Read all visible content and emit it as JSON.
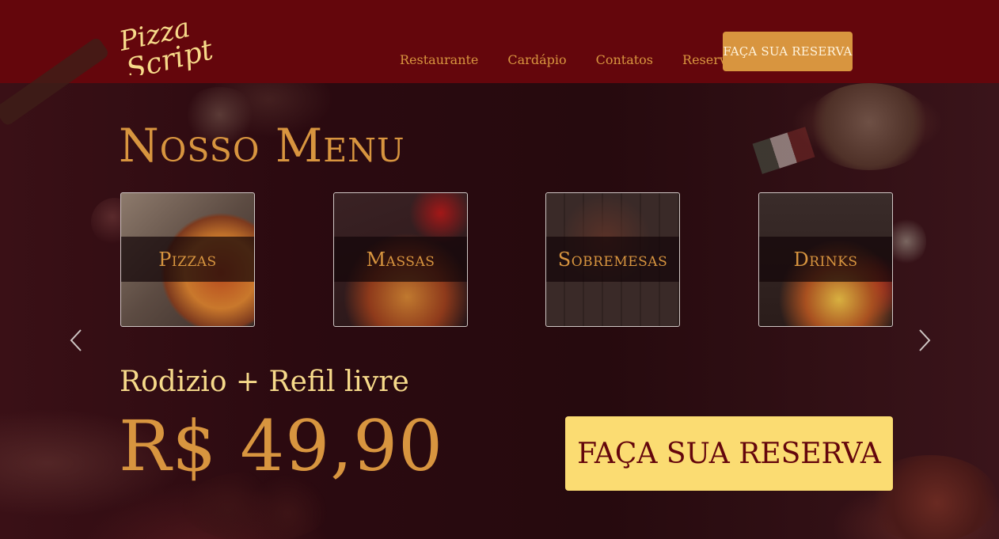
{
  "header": {
    "logo": {
      "line1": "Pizza",
      "line2": "Script"
    },
    "nav": [
      {
        "label": "Restaurante"
      },
      {
        "label": "Cardápio"
      },
      {
        "label": "Contatos"
      },
      {
        "label": "Reservas"
      }
    ],
    "cta_label": "FAÇA SUA RESERVA"
  },
  "hero": {
    "title": "Nosso Menu",
    "menu_cards": [
      {
        "label": "Pizzas"
      },
      {
        "label": "Massas"
      },
      {
        "label": "Sobremesas"
      },
      {
        "label": "Drinks"
      }
    ],
    "rodizio_text": "Rodizio + Refil livre",
    "price": "R$ 49,90",
    "cta_label": "FAÇA SUA RESERVA"
  },
  "colors": {
    "header_bg": "#64060c",
    "accent": "#d8953f",
    "highlight": "#fbdc72",
    "rodizio_text": "#f7da8a"
  },
  "icons": {
    "prev": "chevron-left-icon",
    "next": "chevron-right-icon"
  }
}
